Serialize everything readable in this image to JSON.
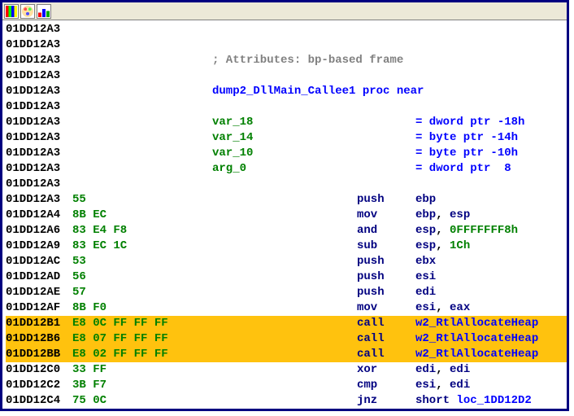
{
  "toolbar": {
    "icon1": "stripes-icon",
    "icon2": "palette-icon",
    "icon3": "chart-icon"
  },
  "listing": [
    {
      "addr": "01DD12A3",
      "bytes": "",
      "text": "",
      "mnemonic": "",
      "operand": ""
    },
    {
      "addr": "01DD12A3",
      "bytes": "",
      "text": "",
      "mnemonic": "",
      "operand": ""
    },
    {
      "addr": "01DD12A3",
      "bytes": "",
      "comment": "; Attributes: bp-based frame"
    },
    {
      "addr": "01DD12A3",
      "bytes": "",
      "text": "",
      "mnemonic": "",
      "operand": ""
    },
    {
      "addr": "01DD12A3",
      "bytes": "",
      "proc": "dump2_DllMain_Callee1 proc near"
    },
    {
      "addr": "01DD12A3",
      "bytes": "",
      "text": "",
      "mnemonic": "",
      "operand": ""
    },
    {
      "addr": "01DD12A3",
      "bytes": "",
      "var": "var_18",
      "vardef": "= dword ptr -18h"
    },
    {
      "addr": "01DD12A3",
      "bytes": "",
      "var": "var_14",
      "vardef": "= byte ptr -14h"
    },
    {
      "addr": "01DD12A3",
      "bytes": "",
      "var": "var_10",
      "vardef": "= byte ptr -10h"
    },
    {
      "addr": "01DD12A3",
      "bytes": "",
      "var": "arg_0",
      "vardef": "= dword ptr  8"
    },
    {
      "addr": "01DD12A3",
      "bytes": "",
      "text": "",
      "mnemonic": "",
      "operand": ""
    },
    {
      "addr": "01DD12A3",
      "bytes": "55",
      "mnemonic": "push",
      "op_kw": "ebp"
    },
    {
      "addr": "01DD12A4",
      "bytes": "8B EC",
      "mnemonic": "mov",
      "op_kw": "ebp",
      "op_sep": ", ",
      "op_kw2": "esp"
    },
    {
      "addr": "01DD12A6",
      "bytes": "83 E4 F8",
      "mnemonic": "and",
      "op_kw": "esp",
      "op_sep": ", ",
      "op_lit": "0FFFFFFF8h"
    },
    {
      "addr": "01DD12A9",
      "bytes": "83 EC 1C",
      "mnemonic": "sub",
      "op_kw": "esp",
      "op_sep": ", ",
      "op_lit": "1Ch"
    },
    {
      "addr": "01DD12AC",
      "bytes": "53",
      "mnemonic": "push",
      "op_kw": "ebx"
    },
    {
      "addr": "01DD12AD",
      "bytes": "56",
      "mnemonic": "push",
      "op_kw": "esi"
    },
    {
      "addr": "01DD12AE",
      "bytes": "57",
      "mnemonic": "push",
      "op_kw": "edi"
    },
    {
      "addr": "01DD12AF",
      "bytes": "8B F0",
      "mnemonic": "mov",
      "op_kw": "esi",
      "op_sep": ", ",
      "op_kw2": "eax"
    },
    {
      "addr": "01DD12B1",
      "bytes": "E8 0C FF FF FF",
      "mnemonic": "call",
      "op_call": "w2_RtlAllocateHeap",
      "hl": true
    },
    {
      "addr": "01DD12B6",
      "bytes": "E8 07 FF FF FF",
      "mnemonic": "call",
      "op_call": "w2_RtlAllocateHeap",
      "hl": true
    },
    {
      "addr": "01DD12BB",
      "bytes": "E8 02 FF FF FF",
      "mnemonic": "call",
      "op_call": "w2_RtlAllocateHeap",
      "hl": true
    },
    {
      "addr": "01DD12C0",
      "bytes": "33 FF",
      "mnemonic": "xor",
      "op_kw": "edi",
      "op_sep": ", ",
      "op_kw2": "edi"
    },
    {
      "addr": "01DD12C2",
      "bytes": "3B F7",
      "mnemonic": "cmp",
      "op_kw": "esi",
      "op_sep": ", ",
      "op_kw2": "edi"
    },
    {
      "addr": "01DD12C4",
      "bytes": "75 0C",
      "mnemonic": "jnz",
      "op_jmp_kw": "short",
      "op_jmp_loc": "loc_1DD12D2"
    }
  ]
}
